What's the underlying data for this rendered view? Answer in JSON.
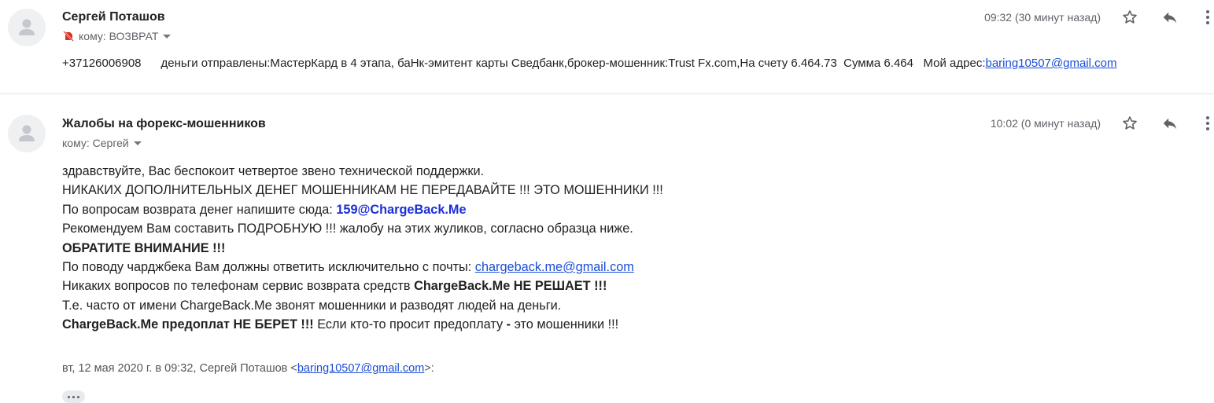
{
  "message1": {
    "sender": "Сергей Поташов",
    "recipient_label": "кому: ВОЗВРАТ",
    "time": "09:32 (30 минут назад)",
    "snippet": {
      "phone": "+37126006908",
      "text": "деньги отправлены:МастерКард в 4 этапа, баНк-эмитент карты Сведбанк,брокер-мошенник:Trust Fx.com,На счету 6.464.73  Сумма 6.464",
      "address_label": "Мой адрес:",
      "address_email": "baring10507@gmail.com"
    },
    "icons": [
      "muted-icon",
      "star-icon",
      "reply-icon",
      "more-icon"
    ]
  },
  "message2": {
    "sender": "Жалобы на форекс-мошенников",
    "recipient_label": "кому: Сергей",
    "time": "10:02 (0 минут назад)",
    "icons": [
      "star-icon",
      "reply-icon",
      "more-icon"
    ],
    "body": {
      "line1": "здравствуйте, Вас беспокоит четвертое звено технической поддержки.",
      "line2": "НИКАКИХ ДОПОЛНИТЕЛЬНЫХ ДЕНЕГ МОШЕННИКАМ НЕ ПЕРЕДАВАЙТЕ !!! ЭТО МОШЕННИКИ !!!",
      "line3_text": "По вопросам возврата денег напишите сюда: ",
      "line3_link": "159@ChargeBack.Me",
      "line4": "Рекомендуем Вам составить ПОДРОБНУЮ !!! жалобу на этих жуликов, согласно образца ниже.",
      "line5": "ОБРАТИТЕ ВНИМАНИЕ !!!",
      "line6_text": "По поводу чарджбека Вам должны ответить исключительно с почты: ",
      "line6_link": "chargeback.me@gmail.com",
      "line7_text": "Никаких вопросов по телефонам сервис возврата средств ",
      "line7_bold": "ChargeBack.Me НЕ РЕШАЕТ !!!",
      "line8": "Т.е. часто от имени ChargeBack.Me звонят мошенники и разводят людей на деньги.",
      "line9_bold1": "ChargeBack.Me предоплат НЕ БЕРЕТ !!!",
      "line9_text1": " Если кто-то просит предоплату ",
      "line9_bold2": "-",
      "line9_text2": " это мошенники !!!"
    },
    "quote": {
      "prefix": "вт, 12 мая 2020 г. в 09:32, Сергей Поташов <",
      "email": "baring10507@gmail.com",
      "suffix": ">:"
    }
  }
}
